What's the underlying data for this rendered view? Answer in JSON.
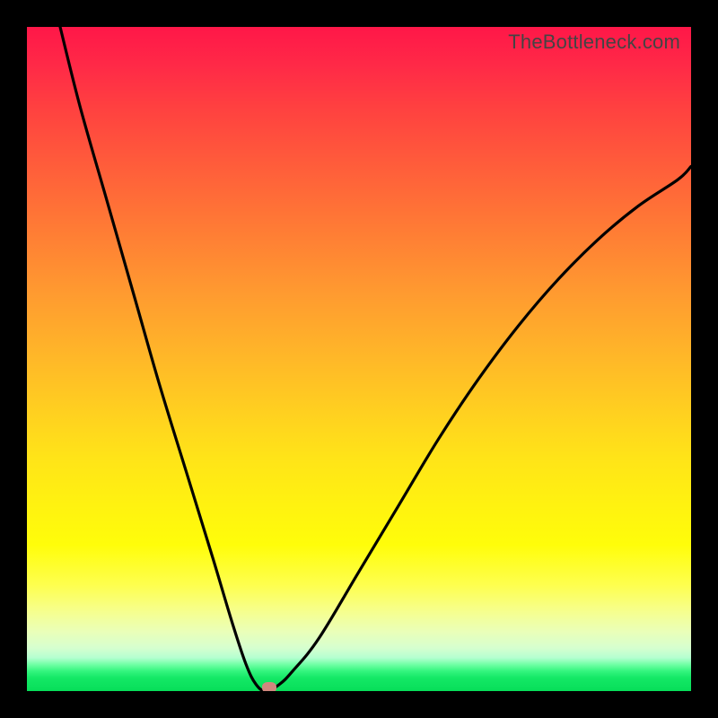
{
  "attribution": "TheBottleneck.com",
  "colors": {
    "border": "#000000",
    "curve": "#000000",
    "marker": "#d1877e"
  },
  "chart_data": {
    "type": "line",
    "title": "",
    "xlabel": "",
    "ylabel": "",
    "xlim": [
      0,
      100
    ],
    "ylim": [
      0,
      100
    ],
    "grid": false,
    "legend": false,
    "annotations": [
      "TheBottleneck.com"
    ],
    "gradient_stops": [
      {
        "pos": 0,
        "color": "#ff1748"
      },
      {
        "pos": 30,
        "color": "#ff7a35"
      },
      {
        "pos": 50,
        "color": "#ffb828"
      },
      {
        "pos": 78,
        "color": "#fffd0a"
      },
      {
        "pos": 93,
        "color": "#d6ffcf"
      },
      {
        "pos": 100,
        "color": "#07de59"
      }
    ],
    "series": [
      {
        "name": "bottleneck-curve",
        "x": [
          5,
          8,
          12,
          16,
          20,
          24,
          28,
          31,
          33,
          34.5,
          36,
          38,
          40,
          44,
          50,
          56,
          62,
          68,
          74,
          80,
          86,
          92,
          98,
          100
        ],
        "y": [
          100,
          88,
          74,
          60,
          46,
          33,
          20,
          10,
          4,
          1,
          0,
          1,
          3,
          8,
          18,
          28,
          38,
          47,
          55,
          62,
          68,
          73,
          77,
          79
        ]
      }
    ],
    "marker": {
      "x": 36.5,
      "y": 0.5
    }
  }
}
